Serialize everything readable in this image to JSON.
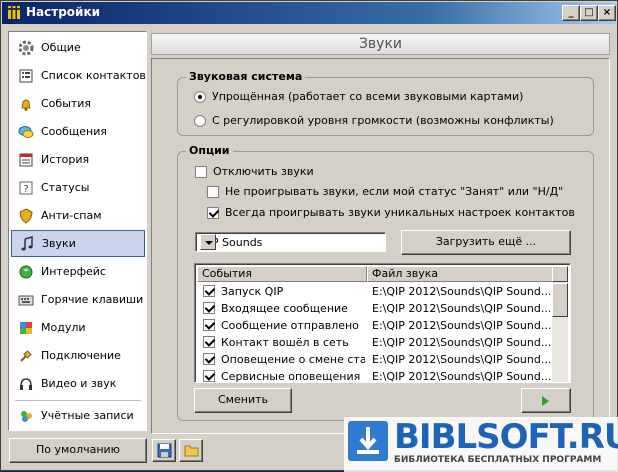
{
  "window": {
    "title": "Настройки"
  },
  "sidebar": {
    "items": [
      {
        "label": "Общие",
        "icon": "gear-icon"
      },
      {
        "label": "Список контактов",
        "icon": "contacts-list-icon"
      },
      {
        "label": "События",
        "icon": "bell-icon"
      },
      {
        "label": "Сообщения",
        "icon": "messages-icon"
      },
      {
        "label": "История",
        "icon": "history-icon"
      },
      {
        "label": "Статусы",
        "icon": "question-icon"
      },
      {
        "label": "Анти-спам",
        "icon": "shield-icon"
      },
      {
        "label": "Звуки",
        "icon": "music-note-icon",
        "selected": true
      },
      {
        "label": "Интерфейс",
        "icon": "interface-icon"
      },
      {
        "label": "Горячие клавиши",
        "icon": "keyboard-icon"
      },
      {
        "label": "Модули",
        "icon": "plugin-icon"
      },
      {
        "label": "Подключение",
        "icon": "plug-icon"
      },
      {
        "label": "Видео и звук",
        "icon": "headphones-icon"
      },
      {
        "label": "Учётные записи",
        "icon": "accounts-icon"
      }
    ]
  },
  "header": {
    "title": "Звуки"
  },
  "sound_system": {
    "title": "Звуковая система",
    "option_simple": "Упрощённая (работает со всеми звуковыми картами)",
    "option_volume": "С регулировкой уровня громкости (возможны конфликты)",
    "selected": "simple"
  },
  "options": {
    "title": "Опции",
    "disable_sounds": {
      "label": "Отключить звуки",
      "checked": false
    },
    "dont_play_busy": {
      "label": "Не проигрывать звуки, если мой статус \"Занят\" или \"Н/Д\"",
      "checked": false
    },
    "always_play_unique": {
      "label": "Всегда проигрывать звуки уникальных настроек контактов",
      "checked": true
    },
    "sound_pack": "QIP Sounds",
    "load_more_button": "Загрузить ещё ...",
    "table": {
      "columns": [
        "События",
        "Файл звука"
      ],
      "rows": [
        {
          "event": "Запуск QIP",
          "file": "E:\\QIP 2012\\Sounds\\QIP Sound...",
          "checked": true
        },
        {
          "event": "Входящее сообщение",
          "file": "E:\\QIP 2012\\Sounds\\QIP Sound...",
          "checked": true
        },
        {
          "event": "Сообщение отправлено",
          "file": "E:\\QIP 2012\\Sounds\\QIP Sound...",
          "checked": true
        },
        {
          "event": "Контакт вошёл в сеть",
          "file": "E:\\QIP 2012\\Sounds\\QIP Sound...",
          "checked": true
        },
        {
          "event": "Оповещение о смене ста...",
          "file": "E:\\QIP 2012\\Sounds\\QIP Sound...",
          "checked": true
        },
        {
          "event": "Сервисные оповещения",
          "file": "E:\\QIP 2012\\Sounds\\QIP Sound...",
          "checked": true
        }
      ]
    },
    "change_button": "Сменить",
    "play_icon": "play-icon"
  },
  "footer": {
    "default_button": "По умолчанию",
    "save_icon": "save-icon",
    "folder_icon": "folder-icon"
  },
  "watermark": {
    "name": "BIBLSOFT.RU",
    "subtitle": "БИБЛИОТЕКА БЕСПЛАТНЫХ ПРОГРАММ"
  },
  "colors": {
    "title_bar": "#0a246a",
    "selected_item": "#c8d5ec",
    "window_bg": "#d4d0c8",
    "play_green": "#2aa12a"
  }
}
